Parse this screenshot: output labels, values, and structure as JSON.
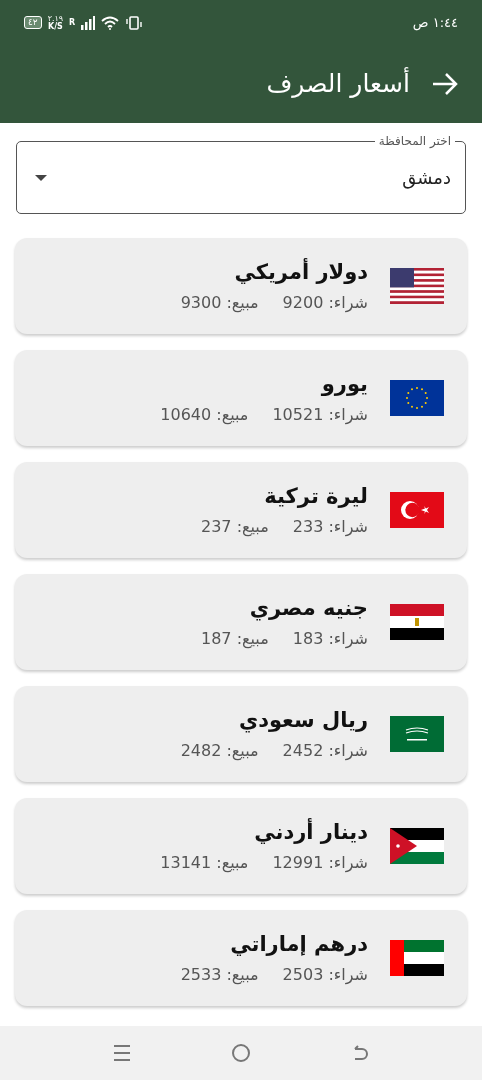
{
  "status_bar": {
    "time": "١:٤٤ ص",
    "battery": "٤٢",
    "speed": "٢.١٩",
    "speed_unit": "K/S",
    "roaming": "R"
  },
  "app_bar": {
    "title": "أسعار الصرف"
  },
  "governorate_select": {
    "label": "اختر المحافظة",
    "value": "دمشق"
  },
  "currencies": [
    {
      "name": "دولار أمريكي",
      "kind": "us",
      "buy": "شراء: 9200",
      "sell": "مبيع: 9300"
    },
    {
      "name": "يورو",
      "kind": "eu",
      "buy": "شراء: 10521",
      "sell": "مبيع: 10640"
    },
    {
      "name": "ليرة تركية",
      "kind": "tr",
      "buy": "شراء: 233",
      "sell": "مبيع: 237"
    },
    {
      "name": "جنيه مصري",
      "kind": "eg",
      "buy": "شراء: 183",
      "sell": "مبيع: 187"
    },
    {
      "name": "ريال سعودي",
      "kind": "sa",
      "buy": "شراء: 2452",
      "sell": "مبيع: 2482"
    },
    {
      "name": "دينار أردني",
      "kind": "jo",
      "buy": "شراء: 12991",
      "sell": "مبيع: 13141"
    },
    {
      "name": "درهم إماراتي",
      "kind": "ae",
      "buy": "شراء: 2503",
      "sell": "مبيع: 2533"
    }
  ]
}
